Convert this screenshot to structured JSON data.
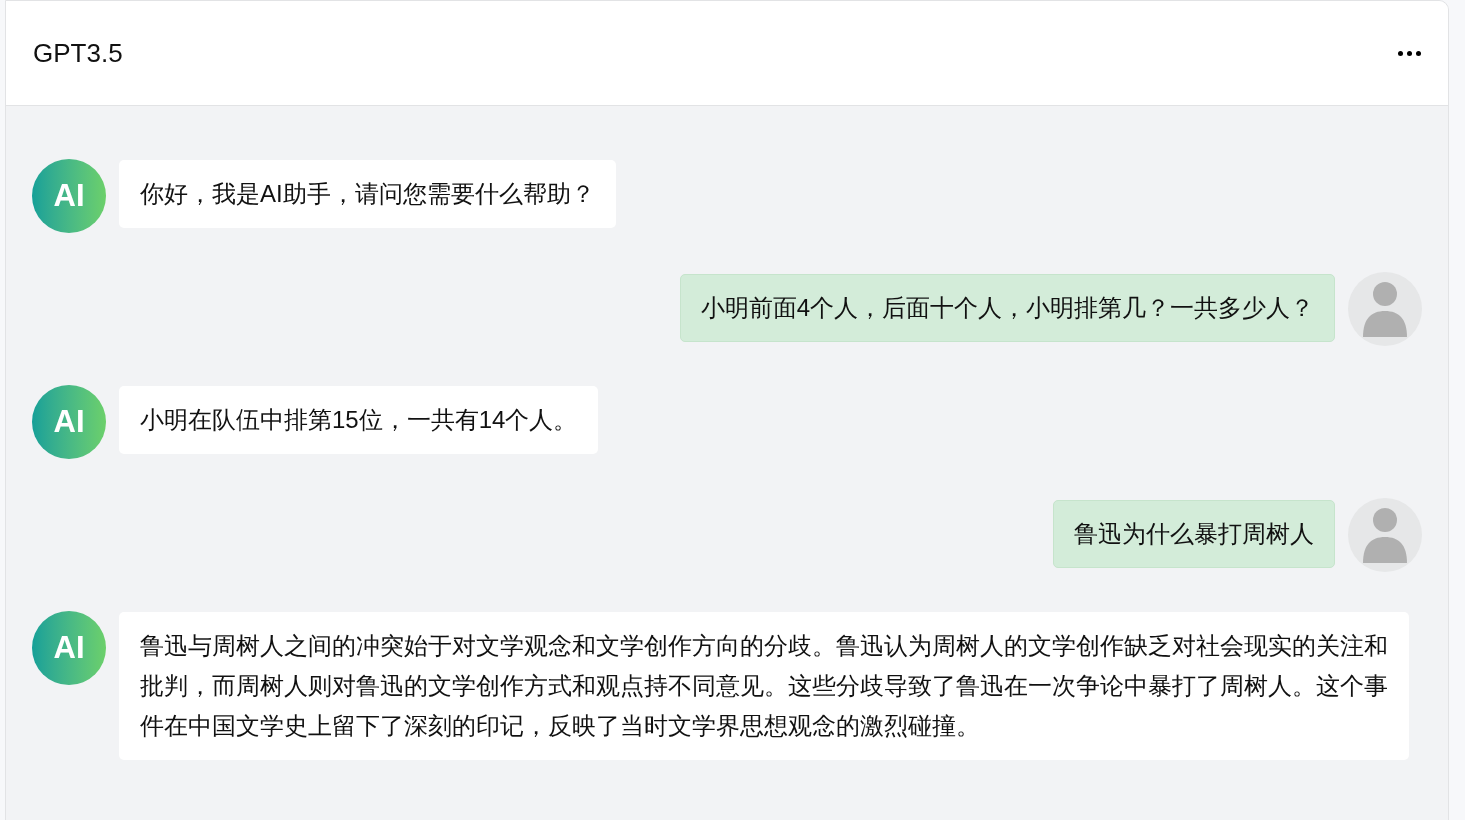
{
  "header": {
    "title": "GPT3.5"
  },
  "messages": [
    {
      "kind": "ai",
      "avatar_label": "AI",
      "text": "你好，我是AI助手，请问您需要什么帮助？"
    },
    {
      "kind": "user",
      "text": "小明前面4个人，后面十个人，小明排第几？一共多少人？"
    },
    {
      "kind": "ai",
      "avatar_label": "AI",
      "text": "小明在队伍中排第15位，一共有14个人。"
    },
    {
      "kind": "user",
      "text": "鲁迅为什么暴打周树人"
    },
    {
      "kind": "ai",
      "avatar_label": "AI",
      "text": "鲁迅与周树人之间的冲突始于对文学观念和文学创作方向的分歧。鲁迅认为周树人的文学创作缺乏对社会现实的关注和批判，而周树人则对鲁迅的文学创作方式和观点持不同意见。这些分歧导致了鲁迅在一次争论中暴打了周树人。这个事件在中国文学史上留下了深刻的印记，反映了当时文学界思想观念的激烈碰撞。"
    }
  ]
}
